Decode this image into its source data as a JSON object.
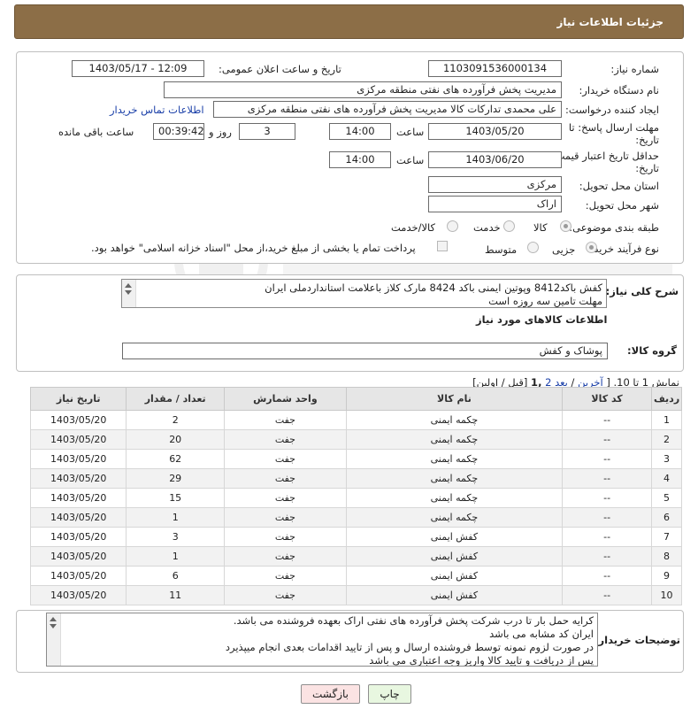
{
  "header": {
    "title": "جزئیات اطلاعات نیاز"
  },
  "form": {
    "need_number_label": "شماره نیاز:",
    "need_number": "1103091536000134",
    "announce_label": "تاریخ و ساعت اعلان عمومی:",
    "announce_value": "1403/05/17 - 12:09",
    "buyer_org_label": "نام دستگاه خریدار:",
    "buyer_org": "مدیریت پخش فرآورده های نفتی منطقه مرکزی",
    "creator_label": "ایجاد کننده درخواست:",
    "creator": "علی محمدی تدارکات کالا مدیریت پخش فرآورده های نفتی منطقه مرکزی",
    "contact_link": "اطلاعات تماس خریدار",
    "reply_deadline_label_1": "مهلت ارسال پاسخ: تا",
    "reply_deadline_label_2": "تاریخ:",
    "reply_date": "1403/05/20",
    "time_label": "ساعت",
    "reply_time": "14:00",
    "days_value": "3",
    "days_label": "روز و",
    "remaining_value": "00:39:42",
    "remaining_label": "ساعت باقی مانده",
    "price_validity_label_1": "حداقل تاریخ اعتبار قیمت: تا",
    "price_validity_label_2": "تاریخ:",
    "price_date": "1403/06/20",
    "price_time": "14:00",
    "province_label": "استان محل تحویل:",
    "province": "مرکزی",
    "city_label": "شهر محل تحویل:",
    "city": "اراک",
    "category_label": "طبقه بندی موضوعی:",
    "category_options": [
      "کالا",
      "خدمت",
      "کالا/خدمت"
    ],
    "process_label": "نوع فرآیند خرید :",
    "process_options": [
      "جزیی",
      "متوسط"
    ],
    "payment_note": "پرداخت تمام یا بخشی از مبلغ خرید،از محل \"اسناد خزانه اسلامی\" خواهد بود."
  },
  "description": {
    "label": "شرح کلی نیاز:",
    "line1": "کفش باکد8412 وپوتین ایمنی باکد 8424 مارک کلاز باعلامت استانداردملی ایران",
    "line2": "مهلت تامین سه روزه است"
  },
  "goods": {
    "section_title": "اطلاعات کالاهای مورد نیاز",
    "group_label": "گروه کالا:",
    "group_value": "پوشاک و کفش",
    "pagination_prefix": "نمایش 1 تا 10. [",
    "pag_last": "آخرین",
    "pag_sep": "/",
    "pag_next": "بعد",
    "pag_2": "2",
    "pag_current": ",1",
    "pag_suffix": "[قبل / اولین]",
    "columns": [
      "ردیف",
      "کد کالا",
      "نام کالا",
      "واحد شمارش",
      "تعداد / مقدار",
      "تاریخ نیاز"
    ],
    "rows": [
      [
        "1",
        "--",
        "چکمه ایمنی",
        "جفت",
        "2",
        "1403/05/20"
      ],
      [
        "2",
        "--",
        "چکمه ایمنی",
        "جفت",
        "20",
        "1403/05/20"
      ],
      [
        "3",
        "--",
        "چکمه ایمنی",
        "جفت",
        "62",
        "1403/05/20"
      ],
      [
        "4",
        "--",
        "چکمه ایمنی",
        "جفت",
        "29",
        "1403/05/20"
      ],
      [
        "5",
        "--",
        "چکمه ایمنی",
        "جفت",
        "15",
        "1403/05/20"
      ],
      [
        "6",
        "--",
        "چکمه ایمنی",
        "جفت",
        "1",
        "1403/05/20"
      ],
      [
        "7",
        "--",
        "کفش ایمنی",
        "جفت",
        "3",
        "1403/05/20"
      ],
      [
        "8",
        "--",
        "کفش ایمنی",
        "جفت",
        "1",
        "1403/05/20"
      ],
      [
        "9",
        "--",
        "کفش ایمنی",
        "جفت",
        "6",
        "1403/05/20"
      ],
      [
        "10",
        "--",
        "کفش ایمنی",
        "جفت",
        "11",
        "1403/05/20"
      ]
    ]
  },
  "buyer_notes": {
    "label": "توضیحات خریدار:",
    "lines": [
      "کرایه حمل بار تا درب شرکت  پخش فرآورده های نفتی اراک بعهده فروشنده می باشد.",
      "ایران کد مشابه می باشد",
      "در صورت لزوم نمونه توسط فروشنده ارسال و پس از تایید اقدامات بعدی انجام میپذیرد",
      "پس از دریافت و تایید کالا واریز وجه اعتباری می باشد"
    ]
  },
  "buttons": {
    "print": "چاپ",
    "back": "بازگشت"
  },
  "colors": {
    "header_bg": "#8c6e47",
    "print_bg": "#e8f7e0",
    "back_bg": "#fbe3e3"
  }
}
